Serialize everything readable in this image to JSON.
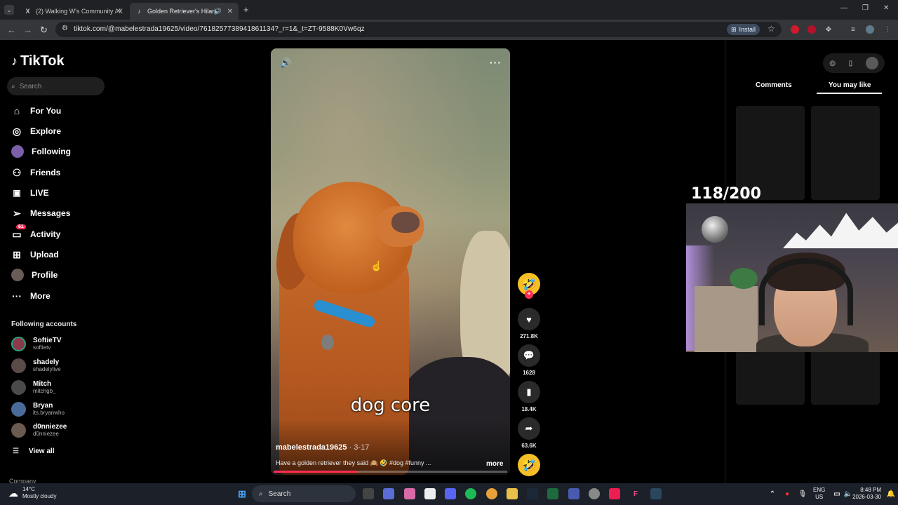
{
  "browser": {
    "tabs": [
      {
        "title": "(2) Walking W's Community / X",
        "icon": "x-icon"
      },
      {
        "title": "Golden Retriever's Hilarious",
        "icon": "tiktok-icon"
      }
    ],
    "url": "tiktok.com/@mabelestrada19625/video/7618257738941861134?_r=1&_t=ZT-9588K0Vw6qz",
    "install_label": "Install"
  },
  "sidebar": {
    "brand": "TikTok",
    "search_placeholder": "Search",
    "nav": [
      {
        "label": "For You",
        "icon": "home-icon"
      },
      {
        "label": "Explore",
        "icon": "compass-icon"
      },
      {
        "label": "Following",
        "icon": "following-avatar"
      },
      {
        "label": "Friends",
        "icon": "friends-icon"
      },
      {
        "label": "LIVE",
        "icon": "live-icon"
      },
      {
        "label": "Messages",
        "icon": "messages-icon"
      },
      {
        "label": "Activity",
        "icon": "activity-icon",
        "badge": "61"
      },
      {
        "label": "Upload",
        "icon": "upload-icon"
      },
      {
        "label": "Profile",
        "icon": "profile-avatar"
      },
      {
        "label": "More",
        "icon": "more-icon"
      }
    ],
    "following_title": "Following accounts",
    "accounts": [
      {
        "name": "SoftieTV",
        "handle": "softietv"
      },
      {
        "name": "shadely",
        "handle": "shadelylive"
      },
      {
        "name": "Mitch",
        "handle": "mitchgb_"
      },
      {
        "name": "Bryan",
        "handle": "its.bryanwho"
      },
      {
        "name": "d0nniezee",
        "handle": "d0nniezee"
      }
    ],
    "view_all": "View all",
    "company": "Company"
  },
  "video": {
    "caption_overlay": "dog core",
    "author": "mabelestrada19625",
    "date": "· 3-17",
    "description": "Have a golden retriever they said 🙉 🤣 #dog #funny ...",
    "more_label": "more",
    "progress": 0.36
  },
  "actions": {
    "likes": "271.8K",
    "comments": "1628",
    "saves": "18.4K",
    "shares": "63.6K"
  },
  "right_panel": {
    "tab_comments": "Comments",
    "tab_you_may_like": "You may like"
  },
  "stream_overlay": {
    "counter": "118/200"
  },
  "taskbar": {
    "weather_temp": "14°C",
    "weather_desc": "Mostly cloudy",
    "search_label": "Search",
    "lang_top": "ENG",
    "lang_bottom": "US",
    "time": "8:48 PM",
    "date": "2026-03-30"
  },
  "colors": {
    "accent": "#fe2c55",
    "page_bg": "#000000",
    "chrome_dark": "#202124"
  }
}
